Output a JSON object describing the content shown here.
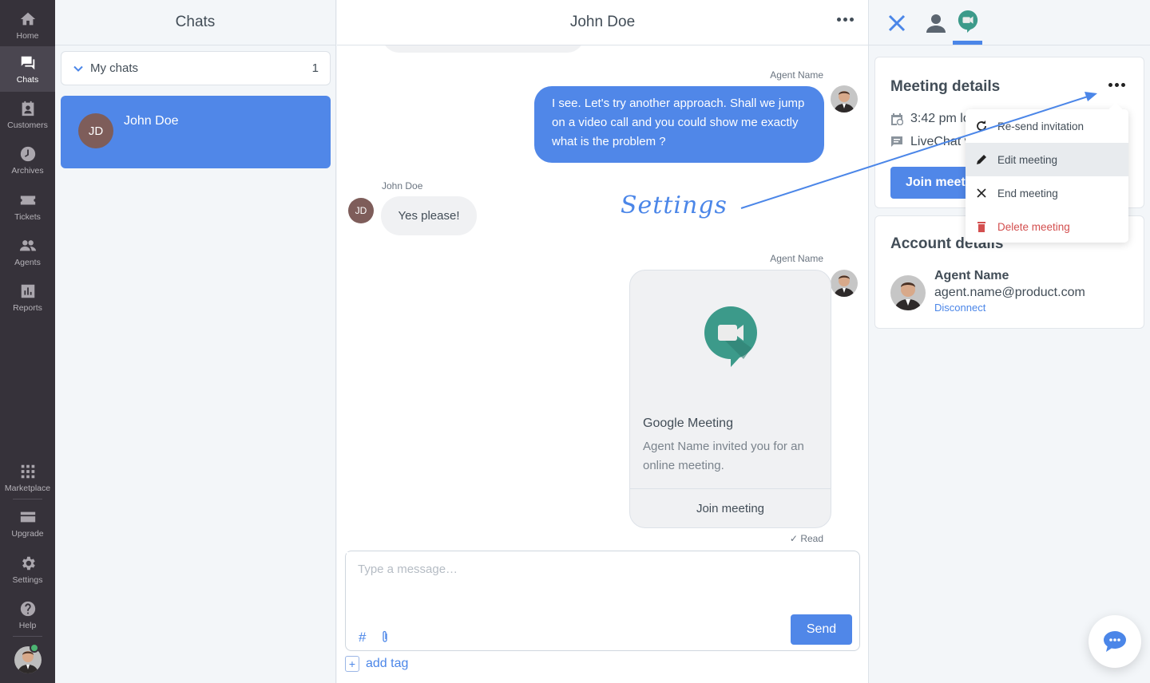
{
  "nav": {
    "items": [
      {
        "label": "Home",
        "icon": "home-icon"
      },
      {
        "label": "Chats",
        "icon": "chats-icon",
        "active": true
      },
      {
        "label": "Customers",
        "icon": "customers-icon"
      },
      {
        "label": "Archives",
        "icon": "archives-icon"
      },
      {
        "label": "Tickets",
        "icon": "tickets-icon"
      },
      {
        "label": "Agents",
        "icon": "agents-icon"
      },
      {
        "label": "Reports",
        "icon": "reports-icon"
      }
    ],
    "bottom_items": [
      {
        "label": "Marketplace",
        "icon": "marketplace-icon"
      },
      {
        "label": "Upgrade",
        "icon": "upgrade-icon"
      },
      {
        "label": "Settings",
        "icon": "settings-icon"
      },
      {
        "label": "Help",
        "icon": "help-icon"
      }
    ],
    "status_color": "#4cb573"
  },
  "chats_panel": {
    "title": "Chats",
    "group": {
      "label": "My chats",
      "count": "1"
    },
    "items": [
      {
        "initials": "JD",
        "name": "John Doe",
        "selected": true
      }
    ]
  },
  "conversation": {
    "title": "John Doe",
    "messages": [
      {
        "author": "Agent Name",
        "text": "I see. Let's try another approach. Shall we jump on a video call and you could show me exactly what is the problem ?"
      },
      {
        "author": "John Doe",
        "initials": "JD",
        "text": "Yes please!"
      },
      {
        "author": "Agent Name",
        "card": {
          "title": "Google Meeting",
          "description": "Agent Name invited you for an online meeting.",
          "action": "Join meeting"
        }
      }
    ],
    "read_status": "Read",
    "annotation": "Settings",
    "composer": {
      "placeholder": "Type a message…",
      "value": "",
      "send_label": "Send",
      "hash_icon": "#"
    },
    "add_tag_label": "add tag"
  },
  "details_panel": {
    "tabs": [
      "close-icon",
      "customer-icon",
      "google-meet-icon"
    ],
    "active_tab": 2,
    "meeting": {
      "title": "Meeting details",
      "time_visible": "3:42 pm lo",
      "source_visible": "LiveChat v",
      "join_visible": "Join meeti"
    },
    "menu": [
      {
        "label": "Re-send invitation",
        "icon": "refresh-icon"
      },
      {
        "label": "Edit meeting",
        "icon": "pencil-icon",
        "hover": true
      },
      {
        "label": "End meeting",
        "icon": "x-icon"
      },
      {
        "label": "Delete meeting",
        "icon": "trash-icon",
        "danger": true
      }
    ],
    "account": {
      "title_visible": "Account details",
      "name": "Agent Name",
      "email": "agent.name@product.com",
      "disconnect_label": "Disconnect"
    }
  },
  "colors": {
    "accent": "#5087e8",
    "sidebar": "#36323a",
    "danger": "#d34f4f",
    "meet_green": "#3c9a8a"
  }
}
